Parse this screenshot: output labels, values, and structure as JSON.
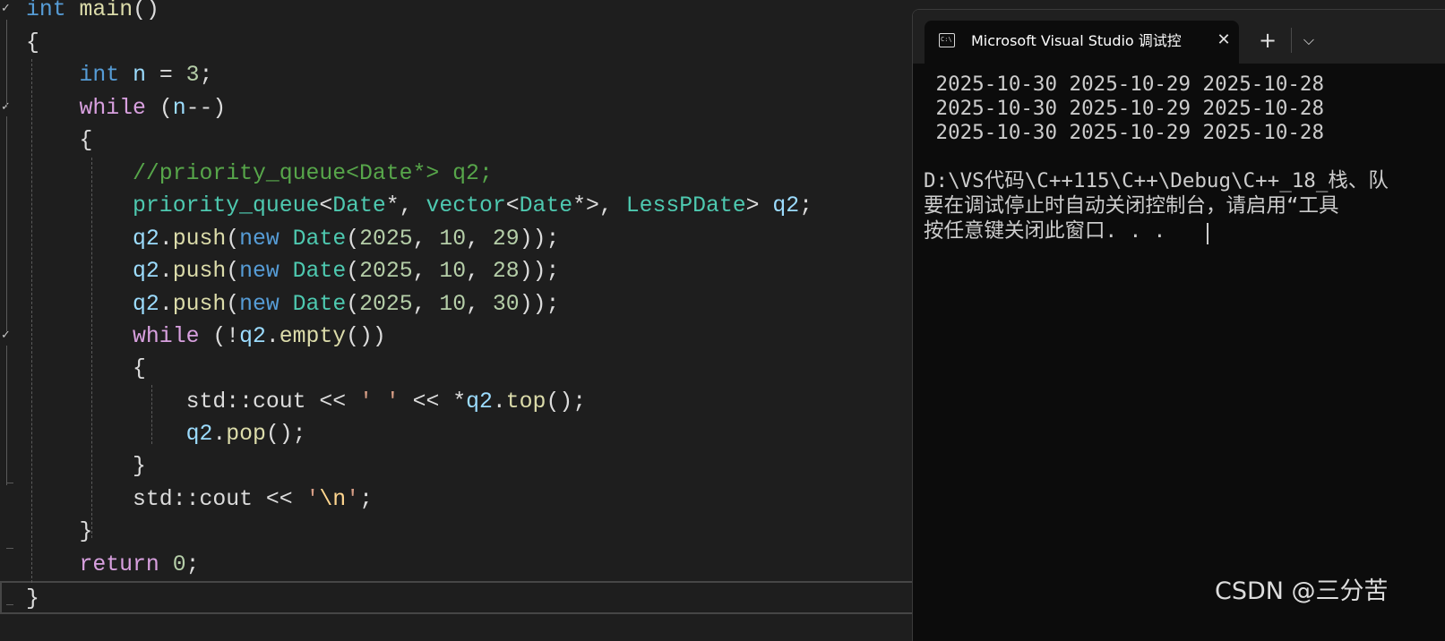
{
  "editor": {
    "lines": [
      [
        {
          "t": "int",
          "c": "kw"
        },
        {
          "t": " "
        },
        {
          "t": "main",
          "c": "fn"
        },
        {
          "t": "()"
        }
      ],
      [
        {
          "t": "{"
        }
      ],
      [
        {
          "t": "    "
        },
        {
          "t": "int",
          "c": "kw"
        },
        {
          "t": " "
        },
        {
          "t": "n",
          "c": "var"
        },
        {
          "t": " = "
        },
        {
          "t": "3",
          "c": "num"
        },
        {
          "t": ";"
        }
      ],
      [
        {
          "t": "    "
        },
        {
          "t": "while",
          "c": "ctl"
        },
        {
          "t": " ("
        },
        {
          "t": "n",
          "c": "var"
        },
        {
          "t": "--)"
        }
      ],
      [
        {
          "t": "    {"
        }
      ],
      [
        {
          "t": "        "
        },
        {
          "t": "//priority_queue<Date*> q2;",
          "c": "cmt"
        }
      ],
      [
        {
          "t": "        "
        },
        {
          "t": "priority_queue",
          "c": "ty"
        },
        {
          "t": "<"
        },
        {
          "t": "Date",
          "c": "ty"
        },
        {
          "t": "*, "
        },
        {
          "t": "vector",
          "c": "ty"
        },
        {
          "t": "<"
        },
        {
          "t": "Date",
          "c": "ty"
        },
        {
          "t": "*>, "
        },
        {
          "t": "LessPDate",
          "c": "ty"
        },
        {
          "t": "> "
        },
        {
          "t": "q2",
          "c": "var"
        },
        {
          "t": ";"
        }
      ],
      [
        {
          "t": "        "
        },
        {
          "t": "q2",
          "c": "var"
        },
        {
          "t": "."
        },
        {
          "t": "push",
          "c": "fn"
        },
        {
          "t": "("
        },
        {
          "t": "new",
          "c": "kw"
        },
        {
          "t": " "
        },
        {
          "t": "Date",
          "c": "ty"
        },
        {
          "t": "("
        },
        {
          "t": "2025",
          "c": "num"
        },
        {
          "t": ", "
        },
        {
          "t": "10",
          "c": "num"
        },
        {
          "t": ", "
        },
        {
          "t": "29",
          "c": "num"
        },
        {
          "t": "));"
        }
      ],
      [
        {
          "t": "        "
        },
        {
          "t": "q2",
          "c": "var"
        },
        {
          "t": "."
        },
        {
          "t": "push",
          "c": "fn"
        },
        {
          "t": "("
        },
        {
          "t": "new",
          "c": "kw"
        },
        {
          "t": " "
        },
        {
          "t": "Date",
          "c": "ty"
        },
        {
          "t": "("
        },
        {
          "t": "2025",
          "c": "num"
        },
        {
          "t": ", "
        },
        {
          "t": "10",
          "c": "num"
        },
        {
          "t": ", "
        },
        {
          "t": "28",
          "c": "num"
        },
        {
          "t": "));"
        }
      ],
      [
        {
          "t": "        "
        },
        {
          "t": "q2",
          "c": "var"
        },
        {
          "t": "."
        },
        {
          "t": "push",
          "c": "fn"
        },
        {
          "t": "("
        },
        {
          "t": "new",
          "c": "kw"
        },
        {
          "t": " "
        },
        {
          "t": "Date",
          "c": "ty"
        },
        {
          "t": "("
        },
        {
          "t": "2025",
          "c": "num"
        },
        {
          "t": ", "
        },
        {
          "t": "10",
          "c": "num"
        },
        {
          "t": ", "
        },
        {
          "t": "30",
          "c": "num"
        },
        {
          "t": "));"
        }
      ],
      [
        {
          "t": "        "
        },
        {
          "t": "while",
          "c": "ctl"
        },
        {
          "t": " (!"
        },
        {
          "t": "q2",
          "c": "var"
        },
        {
          "t": "."
        },
        {
          "t": "empty",
          "c": "fn"
        },
        {
          "t": "())"
        }
      ],
      [
        {
          "t": "        {"
        }
      ],
      [
        {
          "t": "            "
        },
        {
          "t": "std",
          "c": "plain"
        },
        {
          "t": "::"
        },
        {
          "t": "cout",
          "c": "plain"
        },
        {
          "t": " << "
        },
        {
          "t": "' '",
          "c": "str"
        },
        {
          "t": " << *"
        },
        {
          "t": "q2",
          "c": "var"
        },
        {
          "t": "."
        },
        {
          "t": "top",
          "c": "fn"
        },
        {
          "t": "();"
        }
      ],
      [
        {
          "t": "            "
        },
        {
          "t": "q2",
          "c": "var"
        },
        {
          "t": "."
        },
        {
          "t": "pop",
          "c": "fn"
        },
        {
          "t": "();"
        }
      ],
      [
        {
          "t": "        }"
        }
      ],
      [
        {
          "t": "        "
        },
        {
          "t": "std",
          "c": "plain"
        },
        {
          "t": "::"
        },
        {
          "t": "cout",
          "c": "plain"
        },
        {
          "t": " << "
        },
        {
          "t": "'",
          "c": "str"
        },
        {
          "t": "\\n",
          "c": "esc"
        },
        {
          "t": "'",
          "c": "str"
        },
        {
          "t": ";"
        }
      ],
      [
        {
          "t": "    }"
        }
      ],
      [
        {
          "t": "    "
        },
        {
          "t": "return",
          "c": "ctl"
        },
        {
          "t": " "
        },
        {
          "t": "0",
          "c": "num"
        },
        {
          "t": ";"
        }
      ],
      [
        {
          "t": "}"
        }
      ]
    ],
    "fold_icon": "fold-check-icon"
  },
  "console": {
    "tab_icon": "console-app-icon",
    "tab_icon_text": "C:\\",
    "tab_title": "Microsoft Visual Studio 调试控",
    "close_glyph": "✕",
    "new_tab_glyph": "+",
    "dropdown_glyph": "⌵",
    "output_lines": [
      " 2025-10-30 2025-10-29 2025-10-28",
      " 2025-10-30 2025-10-29 2025-10-28",
      " 2025-10-30 2025-10-29 2025-10-28",
      "",
      "D:\\VS代码\\C++115\\C++\\Debug\\C++_18_栈、队",
      "要在调试停止时自动关闭控制台，请启用“工具",
      "按任意键关闭此窗口. . ."
    ]
  },
  "watermark": "CSDN @三分苦"
}
